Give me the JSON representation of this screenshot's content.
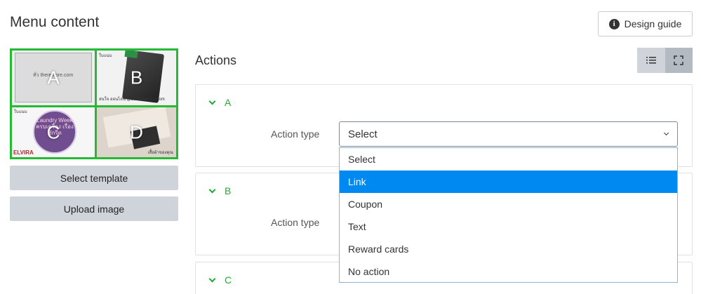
{
  "header": {
    "title": "Menu content",
    "design_guide_label": "Design guide"
  },
  "template": {
    "cells": [
      {
        "letter": "A",
        "caption": "ทั่ว therestore.com"
      },
      {
        "letter": "B",
        "top_text": "ใบแนบ",
        "bottom_text": "สนใจ ออนไลน์ @dedeeanstoracom"
      },
      {
        "letter": "C",
        "top_text": "ใบแนบ",
        "circle_text": "Laundry Week ครบเครื่อง เรื่องซักรีด",
        "brand": "ELVIRA"
      },
      {
        "letter": "D",
        "bottom_text": "เสื้อผ้าของคุณ"
      }
    ],
    "select_template_label": "Select template",
    "upload_image_label": "Upload image"
  },
  "actions": {
    "title": "Actions",
    "panels": [
      {
        "name": "A",
        "field_label": "Action type",
        "value": "Select"
      },
      {
        "name": "B",
        "field_label": "Action type"
      },
      {
        "name": "C"
      }
    ]
  },
  "dropdown": {
    "options": [
      "Select",
      "Link",
      "Coupon",
      "Text",
      "Reward cards",
      "No action"
    ],
    "highlighted": "Link"
  },
  "colors": {
    "accent_green": "#22bb33",
    "highlight_blue": "#0089f0",
    "button_gray": "#cfd4da"
  }
}
